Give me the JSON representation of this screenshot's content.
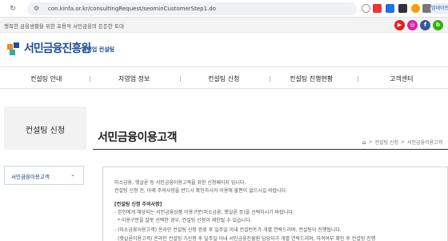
{
  "browser": {
    "url": "con.kinfa.or.kr/consultingRequest/seominCustomerStep1.do",
    "profile_label": "업데이트"
  },
  "top_strip": {
    "slogan": "행복한 금융생활을 위한 포용적 서민금융의 든든한 토대",
    "social": [
      {
        "name": "youtube",
        "glyph": "▶",
        "color": "#e62117"
      },
      {
        "name": "instagram",
        "glyph": "◎",
        "color": "#d6249f"
      },
      {
        "name": "facebook",
        "glyph": "f",
        "color": "#3b5998"
      },
      {
        "name": "blog",
        "glyph": "b",
        "color": "#2db400"
      }
    ]
  },
  "header": {
    "logo_text": "서민금융진흥원",
    "logo_sub": "자영업 컨설팅"
  },
  "gnb": {
    "items": [
      "컨설팅 안내",
      "자영업 정보",
      "컨설팅 신청",
      "컨설팅 진행현황",
      "고객센터"
    ]
  },
  "sidebar": {
    "title": "컨설팅 신청",
    "menu_label": "서민금융이용고객"
  },
  "main": {
    "page_title": "서민금융이용고객",
    "breadcrumb": [
      "컨설팅 신청",
      "서민금융이용고객"
    ],
    "notice": {
      "line1": "미소금융, 햇살론 등 서민금융이용고객을 위한 신청페이지 입니다.",
      "line2": "컨설팅 신청 전, 아래 주의사항을 반드시 확인하시어 이용에 불편이 없으시길 바랍니다.",
      "heading": "[컨설팅 신청 주의사항]",
      "line3": "- 본인에게 해당되는 서민금융상품 이용구분(미소금융, 햇살론 등)을 선택하시기 바랍니다.",
      "line4": "* 이용구분을 잘못 선택한 경우, 컨설팅 신청이 제한될 수 있습니다.",
      "line5": "- (미소금융이용고객) 온라인 컨설팅 신청 완료 후 일주일 이내 컨설턴트가 개별 연락드리며, 컨설팅이 진행됩니다.",
      "line6": "(햇살론이용고객) 온라인 컨설팅 가신청 후 일주일 이내 서민금융진흥원 담당자가 개별 연락드리며, 자격여부 확인 후 컨설팅 진행"
    }
  }
}
